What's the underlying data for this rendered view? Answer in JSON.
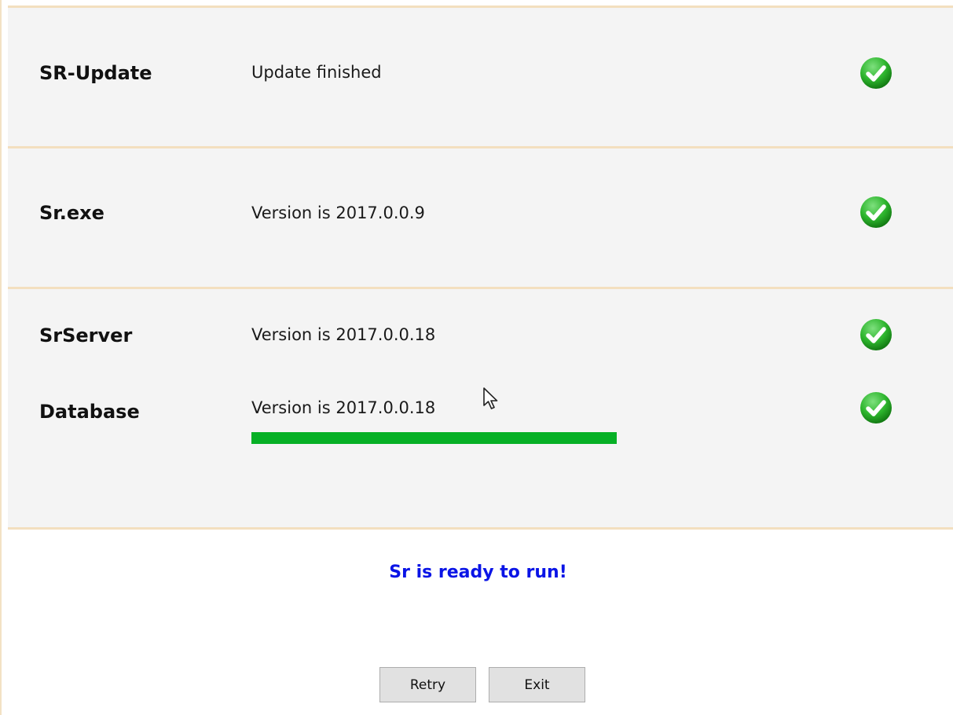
{
  "rows": [
    {
      "name": "SR-Update",
      "status": "Update finished",
      "icon": "check-circle-icon"
    },
    {
      "name": "Sr.exe",
      "status": "Version is 2017.0.0.9",
      "icon": "check-circle-icon"
    },
    {
      "name": "SrServer",
      "status": "Version is 2017.0.0.18",
      "icon": "check-circle-icon"
    },
    {
      "name": "Database",
      "status": "Version is 2017.0.0.18",
      "icon": "check-circle-icon"
    }
  ],
  "progress": {
    "value_percent": 100
  },
  "message": "Sr is ready to run!",
  "buttons": {
    "retry": "Retry",
    "exit": "Exit"
  },
  "colors": {
    "progress": "#06b025",
    "message": "#0a14e6",
    "check": "#2db52d",
    "panel": "#f4f4f4",
    "divider": "#f3dfbf"
  }
}
